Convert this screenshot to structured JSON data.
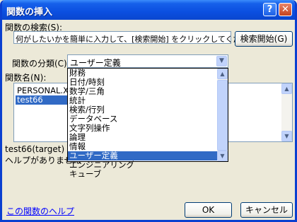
{
  "window": {
    "title": "関数の挿入",
    "help_glyph": "?",
    "close_glyph": "✕"
  },
  "search": {
    "label": "関数の検索(S):",
    "value": "何がしたいかを簡単に入力して、[検索開始] をクリックしてください。",
    "button": "検索開始(G)"
  },
  "category": {
    "label": "関数の分類(C):",
    "selected": "ユーザー定義",
    "options": [
      "財務",
      "日付/時刻",
      "数学/三角",
      "統計",
      "検索/行列",
      "データベース",
      "文字列操作",
      "論理",
      "情報",
      "ユーザー定義",
      "エンジニアリング",
      "キューブ"
    ],
    "selected_index": 9
  },
  "functions": {
    "label": "関数名(N):",
    "items": [
      "PERSONAL.XLS",
      "test66"
    ],
    "selected_index": 1
  },
  "description": {
    "signature": "test66(target)",
    "text": "ヘルプがありません"
  },
  "footer": {
    "help_link": "この関数のヘルプ",
    "ok": "OK",
    "cancel": "キャンセル"
  },
  "colors": {
    "selection": "#316ac5",
    "title_bar": "#0b4fe0",
    "link": "#0000ff"
  }
}
